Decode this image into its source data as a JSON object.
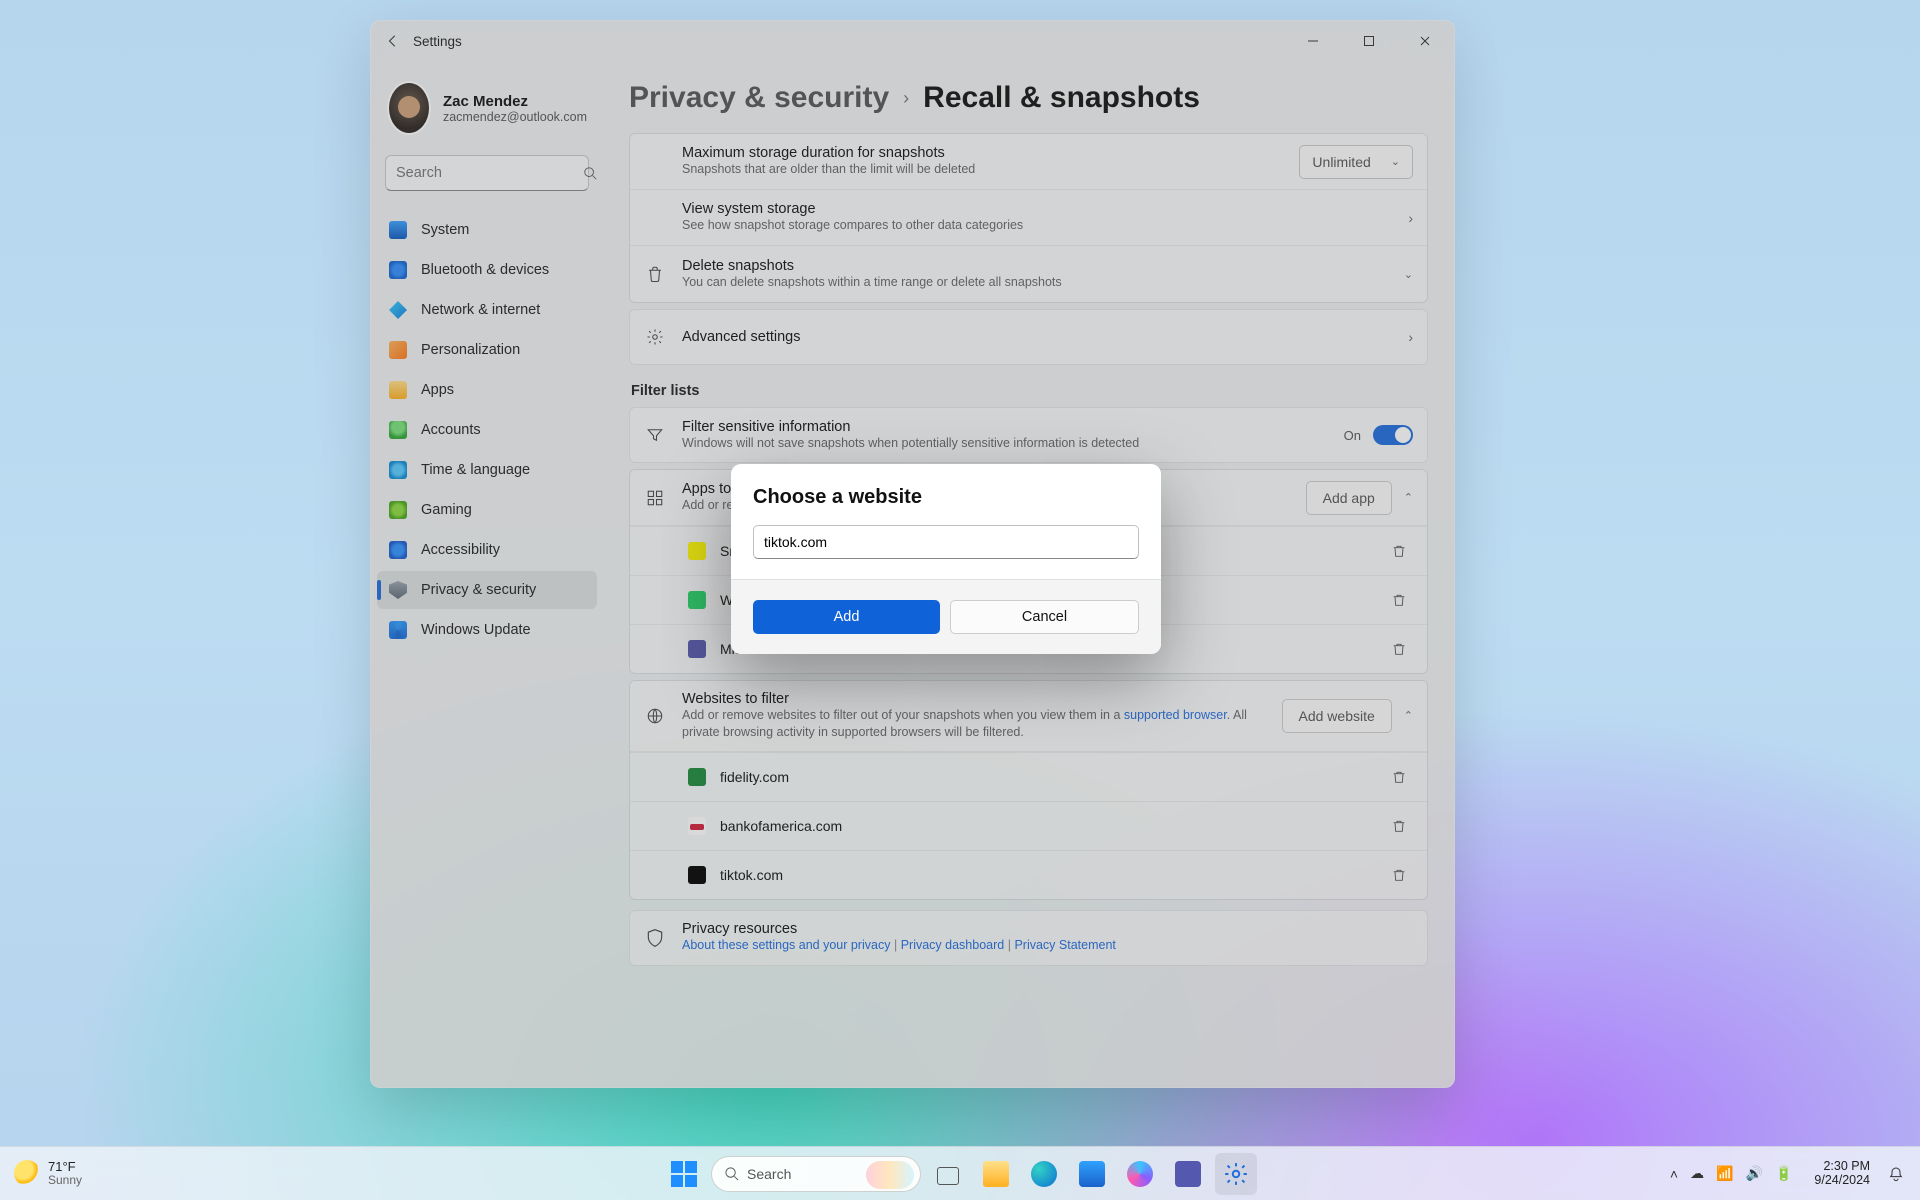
{
  "window": {
    "title": "Settings",
    "profile": {
      "name": "Zac Mendez",
      "email": "zacmendez@outlook.com"
    },
    "search_placeholder": "Search",
    "nav": {
      "system": "System",
      "bluetooth": "Bluetooth & devices",
      "network": "Network & internet",
      "personalization": "Personalization",
      "apps": "Apps",
      "accounts": "Accounts",
      "time": "Time & language",
      "gaming": "Gaming",
      "a11y": "Accessibility",
      "privacy": "Privacy & security",
      "update": "Windows Update"
    },
    "breadcrumb": {
      "parent": "Privacy & security",
      "current": "Recall & snapshots"
    },
    "rows": {
      "max_storage": {
        "title": "Maximum storage duration for snapshots",
        "sub": "Snapshots that are older than the limit will be deleted",
        "value": "Unlimited"
      },
      "view_storage": {
        "title": "View system storage",
        "sub": "See how snapshot storage compares to other data categories"
      },
      "delete_snapshots": {
        "title": "Delete snapshots",
        "sub": "You can delete snapshots within a time range or delete all snapshots"
      },
      "advanced": {
        "title": "Advanced settings"
      }
    },
    "filter": {
      "section": "Filter lists",
      "sensitive": {
        "title": "Filter sensitive information",
        "sub": "Windows will not save snapshots when potentially sensitive information is detected",
        "state": "On"
      },
      "apps": {
        "title": "Apps to filter",
        "sub": "Add or remove apps to filter out of your snapshots",
        "btn": "Add app",
        "items": [
          "Snapchat",
          "WhatsApp",
          "Microsoft Teams"
        ]
      },
      "websites": {
        "title": "Websites to filter",
        "sub_pre": "Add or remove websites to filter out of your snapshots when you view them in a ",
        "sub_link": "supported browser",
        "sub_post": ". All private browsing activity in supported browsers will be filtered.",
        "btn": "Add website",
        "items": [
          "fidelity.com",
          "bankofamerica.com",
          "tiktok.com"
        ]
      }
    },
    "privacy_resources": {
      "title": "Privacy resources",
      "l1": "About these settings and your privacy",
      "l2": "Privacy dashboard",
      "l3": "Privacy Statement"
    }
  },
  "modal": {
    "title": "Choose a website",
    "value": "tiktok.com",
    "add": "Add",
    "cancel": "Cancel"
  },
  "taskbar": {
    "weather_temp": "71°F",
    "weather_cond": "Sunny",
    "search": "Search",
    "time": "2:30 PM",
    "date": "9/24/2024"
  }
}
